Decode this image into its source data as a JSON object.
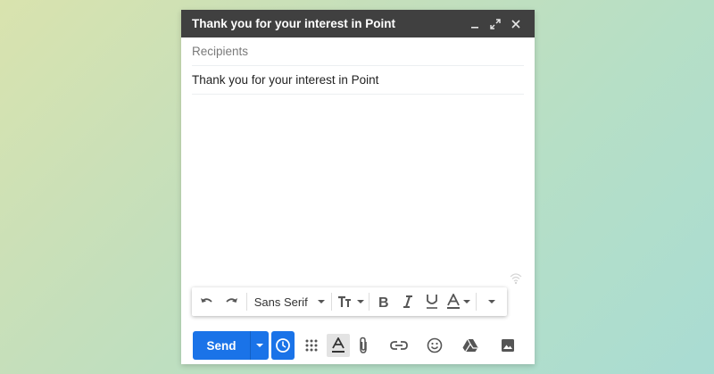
{
  "compose": {
    "title": "Thank you for your interest in Point",
    "recipients_placeholder": "Recipients",
    "subject": "Thank you for your interest in Point",
    "body": ""
  },
  "format_toolbar": {
    "font": "Sans Serif"
  },
  "bottom_toolbar": {
    "send_label": "Send"
  },
  "colors": {
    "header_bg": "#404040",
    "send_blue": "#1a73e8",
    "icon_gray": "#555555"
  }
}
